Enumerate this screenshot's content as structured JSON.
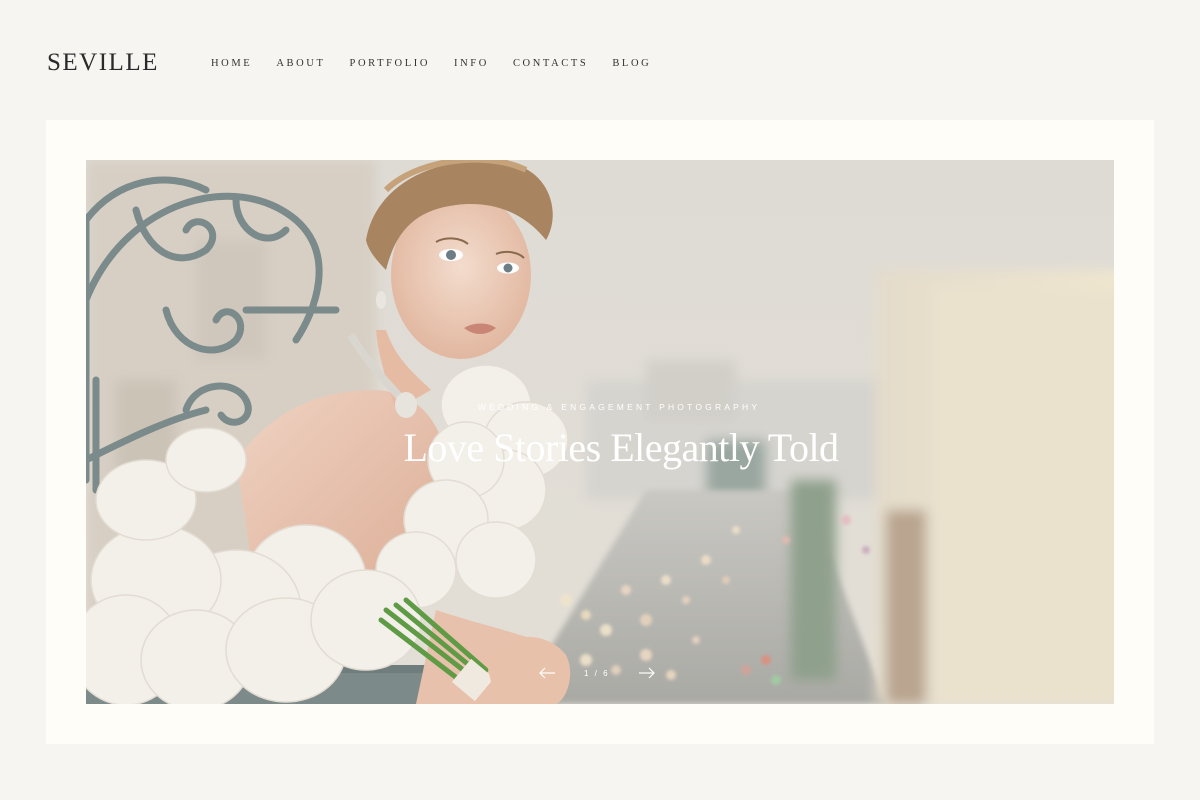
{
  "brand": {
    "logo": "SEVILLE"
  },
  "nav": {
    "items": [
      {
        "label": "HOME"
      },
      {
        "label": "ABOUT"
      },
      {
        "label": "PORTFOLIO"
      },
      {
        "label": "INFO"
      },
      {
        "label": "CONTACTS"
      },
      {
        "label": "BLOG"
      }
    ]
  },
  "hero": {
    "eyebrow": "WEDDING & ENGAGEMENT PHOTOGRAPHY",
    "title": "Love Stories Elegantly Told",
    "counter": "1 / 6",
    "prev_icon": "arrow-left-icon",
    "next_icon": "arrow-right-icon"
  },
  "colors": {
    "page_background": "#f6f5f1",
    "frame_background": "#fefdf8",
    "text": "#2d2d2d",
    "hero_text": "#ffffff"
  }
}
